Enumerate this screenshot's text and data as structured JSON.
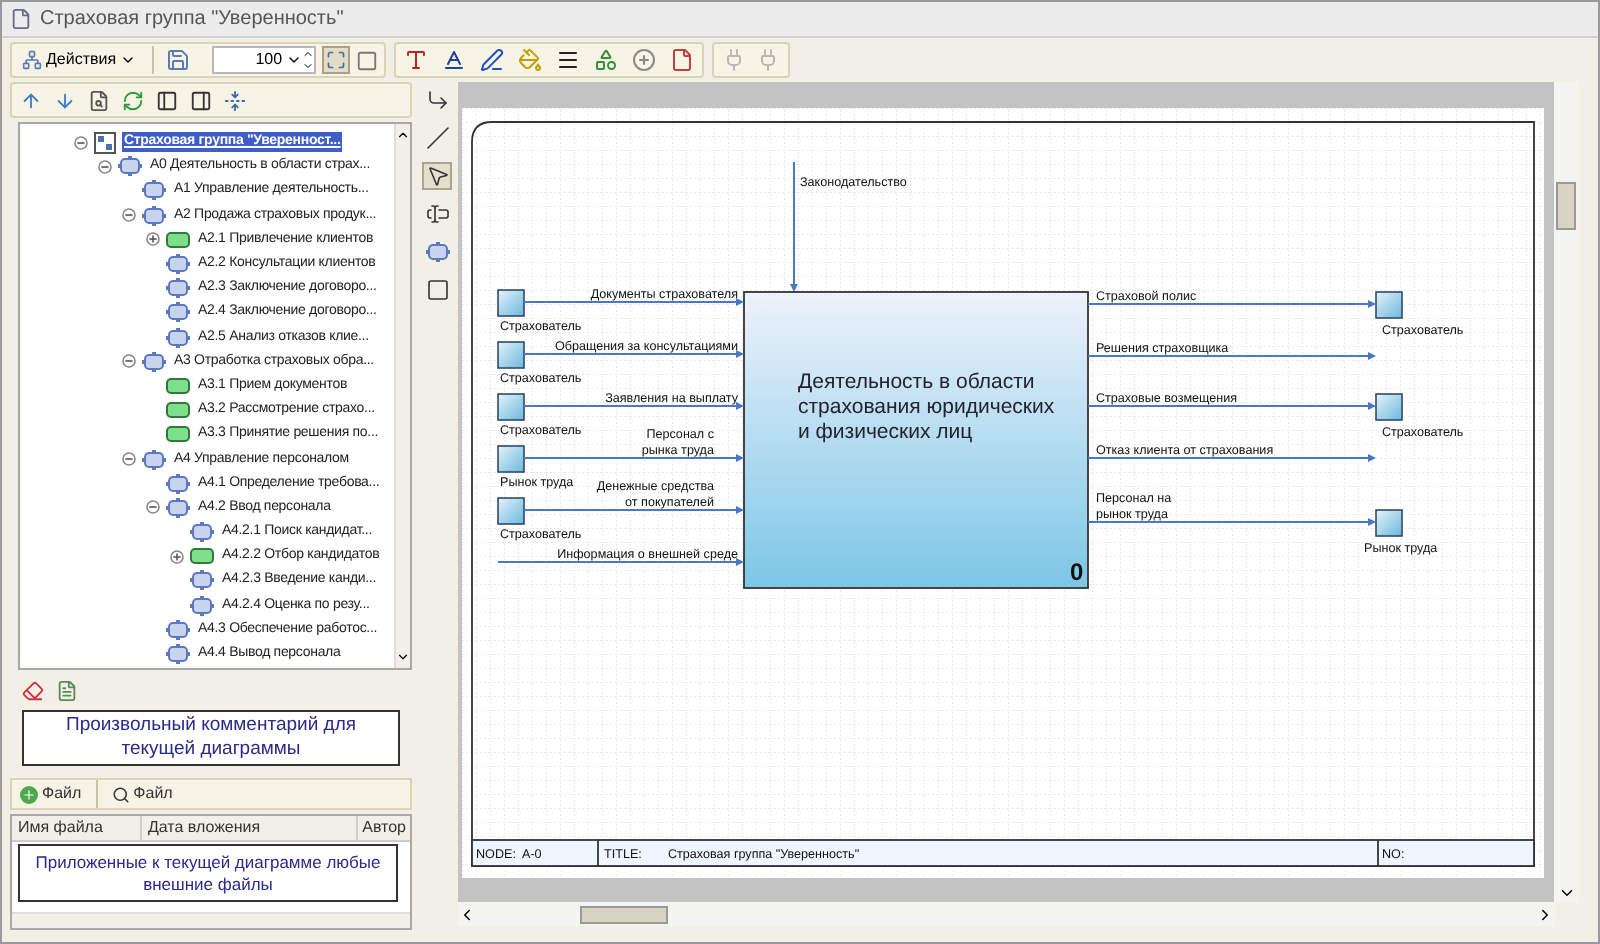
{
  "window": {
    "title": "Страховая группа \"Уверенность\""
  },
  "toolbar": {
    "actions_label": "Действия",
    "zoom": "100",
    "fit_pressed": true
  },
  "tools": [
    {
      "kind": "connector",
      "selected": false
    },
    {
      "kind": "line",
      "selected": false
    },
    {
      "kind": "pointer",
      "selected": true
    },
    {
      "kind": "text",
      "selected": false
    },
    {
      "kind": "activity",
      "selected": false
    },
    {
      "kind": "frame",
      "selected": false
    }
  ],
  "tree": [
    {
      "label": "Страховая группа \"Уверенност...",
      "kind": "diagram",
      "selected": true,
      "expanded": true,
      "children": [
        {
          "label": "А0 Деятельность в области страх...",
          "kind": "activity",
          "selected": false,
          "expanded": true,
          "children": [
            {
              "label": "А1 Управление деятельность...",
              "kind": "activity",
              "selected": false
            },
            {
              "label": "А2 Продажа страховых продук...",
              "kind": "activity",
              "selected": false,
              "expanded": true,
              "children": [
                {
                  "label": "А2.1 Привлечение клиентов",
                  "kind": "process",
                  "selected": false,
                  "expanded": false
                },
                {
                  "label": "А2.2 Консультации клиентов",
                  "kind": "activity",
                  "selected": false
                },
                {
                  "label": "А2.3 Заключение договоро...",
                  "kind": "activity",
                  "selected": false
                },
                {
                  "label": "А2.4 Заключение договоро...",
                  "kind": "activity",
                  "selected": false
                },
                {
                  "label": "А2.5 Анализ отказов клие...",
                  "kind": "activity",
                  "selected": false
                }
              ]
            },
            {
              "label": "А3 Отработка страховых обра...",
              "kind": "activity",
              "selected": false,
              "expanded": true,
              "children": [
                {
                  "label": "А3.1 Прием документов",
                  "kind": "process",
                  "selected": false
                },
                {
                  "label": "А3.2 Рассмотрение страхо...",
                  "kind": "process",
                  "selected": false
                },
                {
                  "label": "А3.3 Принятие решения по...",
                  "kind": "process",
                  "selected": false
                }
              ]
            },
            {
              "label": "А4 Управление персоналом",
              "kind": "activity",
              "selected": false,
              "expanded": true,
              "children": [
                {
                  "label": "А4.1 Определение требова...",
                  "kind": "activity",
                  "selected": false
                },
                {
                  "label": "А4.2 Ввод персонала",
                  "kind": "activity",
                  "selected": false,
                  "expanded": true,
                  "children": [
                    {
                      "label": "А4.2.1 Поиск кандидат...",
                      "kind": "activity",
                      "selected": false
                    },
                    {
                      "label": "А4.2.2 Отбор кандидатов",
                      "kind": "process",
                      "selected": false,
                      "expanded": false
                    },
                    {
                      "label": "А4.2.3 Введение канди...",
                      "kind": "activity",
                      "selected": false
                    },
                    {
                      "label": "А4.2.4 Оценка по резу...",
                      "kind": "activity",
                      "selected": false
                    }
                  ]
                },
                {
                  "label": "А4.3 Обеспечение работос...",
                  "kind": "activity",
                  "selected": false
                },
                {
                  "label": "А4.4 Вывод персонала",
                  "kind": "activity",
                  "selected": false
                }
              ]
            }
          ]
        }
      ]
    }
  ],
  "comment": "Произвольный комментарий для текущей диаграммы",
  "file_buttons": [
    {
      "kind": "add",
      "label": "Файл"
    },
    {
      "kind": "search",
      "label": "Файл"
    }
  ],
  "file_columns": [
    "Имя файла",
    "Дата вложения",
    "Автор"
  ],
  "files_note": "Приложенные к текущей диаграмме любые внешние файлы",
  "diagram": {
    "activity": {
      "lines": [
        "Деятельность в области",
        "страхования юридических",
        "и физических лиц"
      ],
      "number": "0"
    },
    "control": {
      "lines": [
        "Законодательство"
      ]
    },
    "inputs": [
      {
        "lines": [
          "Документы страхователя"
        ],
        "source": "Страхователь"
      },
      {
        "lines": [
          "Обращения за консультациями"
        ],
        "source": "Страхователь"
      },
      {
        "lines": [
          "Заявления на выплату"
        ],
        "source": "Страхователь"
      },
      {
        "lines": [
          "Персонал с",
          "рынка труда"
        ],
        "source": "Рынок труда"
      },
      {
        "lines": [
          "Денежные средства",
          "от покупателей"
        ],
        "source": "Страхователь"
      },
      {
        "lines": [
          "Информация о внешней среде"
        ]
      }
    ],
    "outputs": [
      {
        "lines": [
          "Страховой полис"
        ],
        "target": "Страхователь"
      },
      {
        "lines": [
          "Решения страховщика"
        ]
      },
      {
        "lines": [
          "Страховые возмещения"
        ],
        "target": "Страхователь"
      },
      {
        "lines": [
          "Отказ клиента от страхования"
        ]
      },
      {
        "lines": [
          "Персонал на",
          "рынок труда"
        ],
        "target": "Рынок труда"
      }
    ],
    "footer": {
      "node_label": "NODE:",
      "node": "A-0",
      "title_label": "TITLE:",
      "title": "Страховая группа \"Уверенность\"",
      "no_label": "NO:"
    }
  }
}
